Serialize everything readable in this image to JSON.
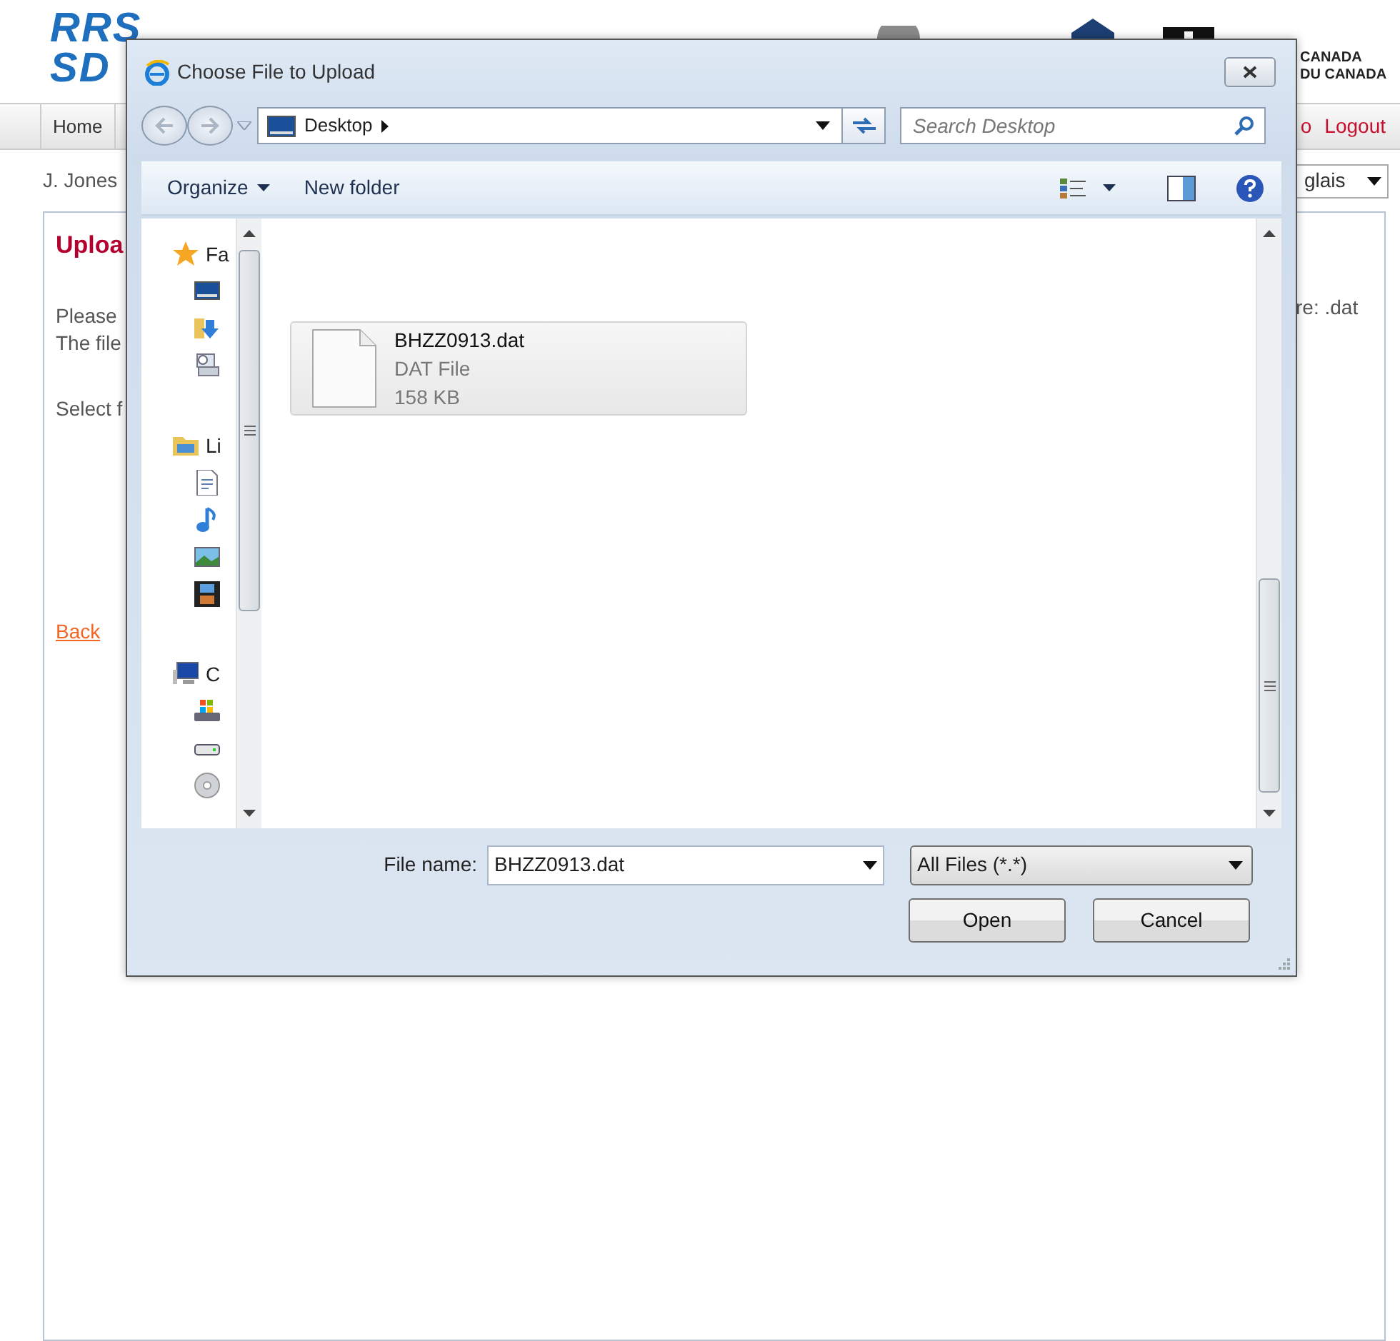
{
  "page": {
    "logo": [
      "RRS",
      "SD"
    ],
    "org_lines": [
      "CANADA",
      "DU CANADA"
    ],
    "nav_left": [
      {
        "label": "Home"
      }
    ],
    "nav_right": [
      {
        "label": "o"
      },
      {
        "label": "Logout"
      }
    ],
    "user": "J. Jones",
    "language": "glais",
    "content": {
      "title": "Uploa",
      "lines_left": [
        "Please",
        "The file"
      ],
      "line_right": "re: .dat",
      "select_label": "Select f",
      "back_link": "Back"
    }
  },
  "dialog": {
    "title": "Choose File to Upload",
    "location": "Desktop",
    "search": {
      "placeholder": "Search Desktop"
    },
    "toolbar": [
      {
        "label": "Organize",
        "dropdown": true
      },
      {
        "label": "New folder",
        "dropdown": false
      }
    ],
    "nav_pane": [
      {
        "label": "Fa",
        "kind": "favorites"
      },
      {
        "label": "Li",
        "kind": "libraries"
      },
      {
        "label": "C",
        "kind": "computer"
      }
    ],
    "files": [
      {
        "name": "BHZZ0913.dat",
        "type": "DAT File",
        "size": "158 KB",
        "selected": true
      }
    ],
    "file_name_label": "File name:",
    "file_name": "BHZZ0913.dat",
    "filter": "All Files (*.*)",
    "buttons": [
      "Open",
      "Cancel"
    ]
  }
}
